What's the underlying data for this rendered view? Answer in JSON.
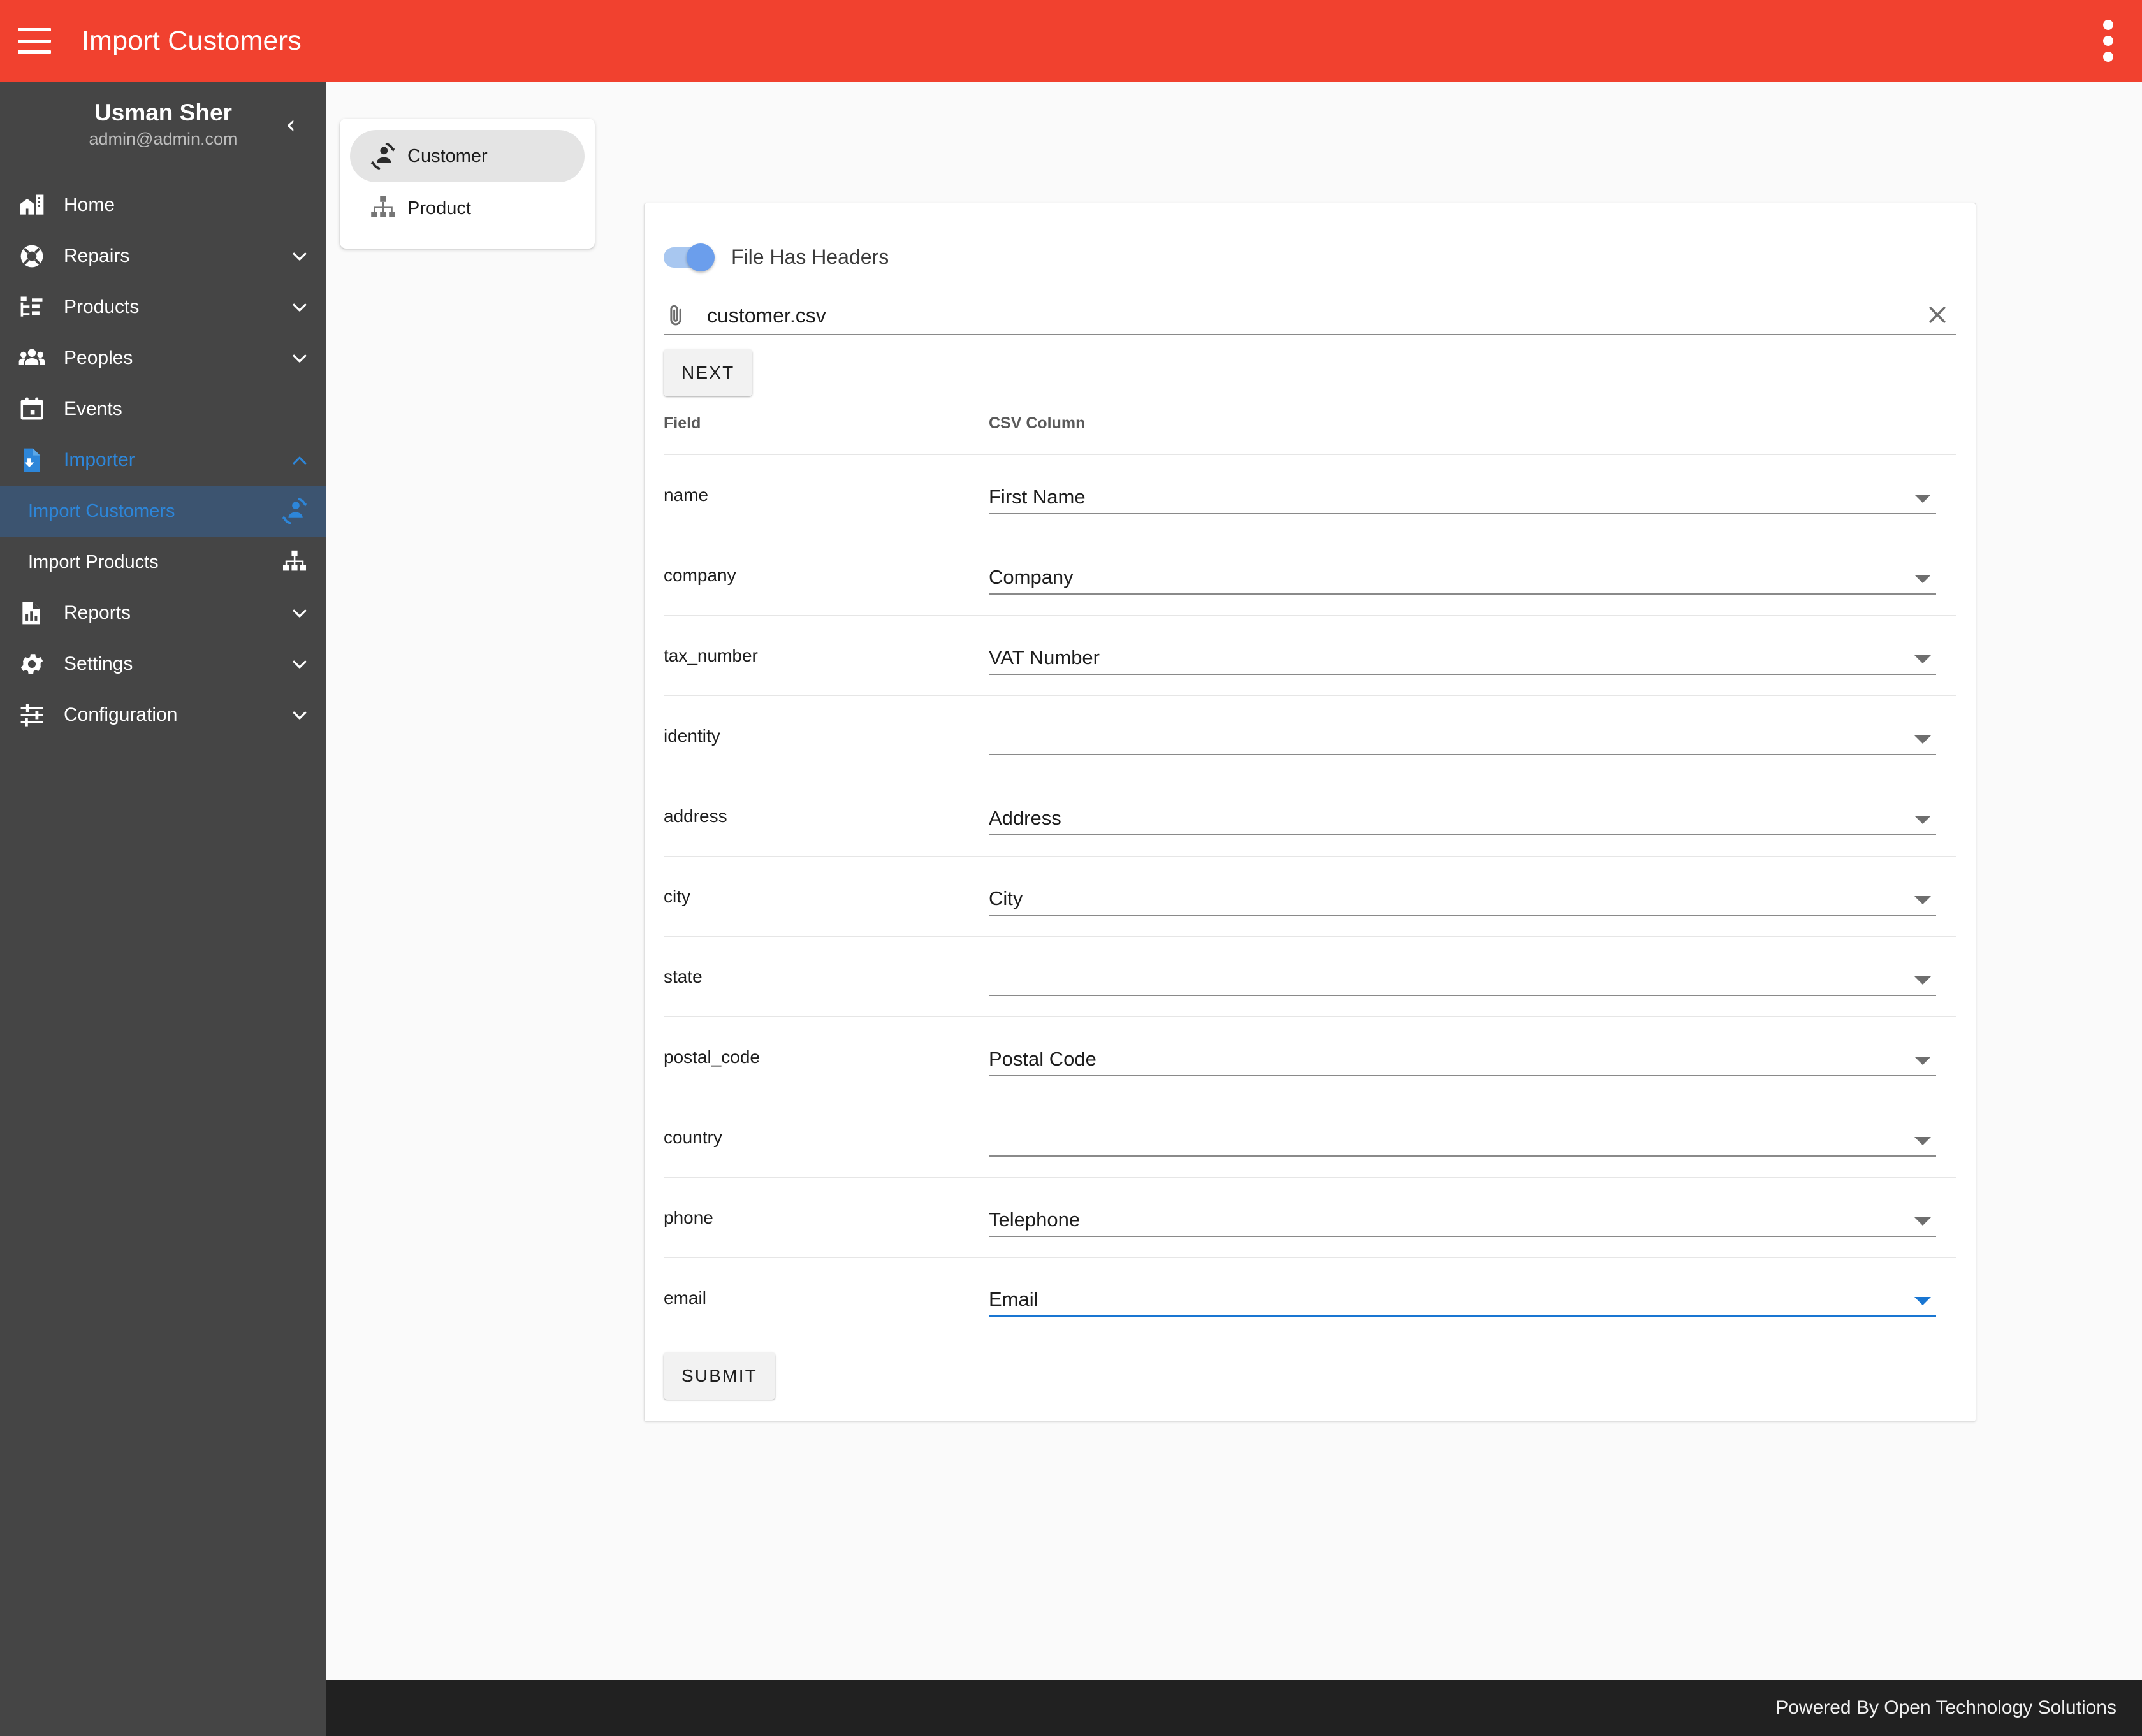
{
  "appbar": {
    "title": "Import Customers",
    "menu_icon": "hamburger-icon",
    "overflow_icon": "kebab-menu-icon"
  },
  "sidebar": {
    "user": {
      "name": "Usman Sher",
      "email": "admin@admin.com",
      "collapse_icon": "chevron-left-icon"
    },
    "items": [
      {
        "label": "Home",
        "icon": "home-building-icon",
        "expandable": false,
        "state": ""
      },
      {
        "label": "Repairs",
        "icon": "lifebuoy-icon",
        "expandable": true,
        "state": "collapsed"
      },
      {
        "label": "Products",
        "icon": "tree-list-icon",
        "expandable": true,
        "state": "collapsed"
      },
      {
        "label": "Peoples",
        "icon": "people-group-icon",
        "expandable": true,
        "state": "collapsed"
      },
      {
        "label": "Events",
        "icon": "calendar-icon",
        "expandable": false,
        "state": ""
      },
      {
        "label": "Importer",
        "icon": "file-import-icon",
        "expandable": true,
        "state": "expanded"
      }
    ],
    "importer_children": [
      {
        "label": "Import Customers",
        "icon": "customer-import-icon",
        "selected": true
      },
      {
        "label": "Import Products",
        "icon": "sitemap-icon",
        "selected": false
      }
    ],
    "items_after": [
      {
        "label": "Reports",
        "icon": "report-chart-icon",
        "expandable": true,
        "state": "collapsed"
      },
      {
        "label": "Settings",
        "icon": "gear-icon",
        "expandable": true,
        "state": "collapsed"
      },
      {
        "label": "Configuration",
        "icon": "sliders-icon",
        "expandable": true,
        "state": "collapsed"
      }
    ]
  },
  "entity_selector": {
    "items": [
      {
        "label": "Customer",
        "icon": "customer-import-icon",
        "selected": true
      },
      {
        "label": "Product",
        "icon": "sitemap-icon",
        "selected": false
      }
    ]
  },
  "form": {
    "headers_toggle": {
      "label": "File Has Headers",
      "on": true
    },
    "file": {
      "name": "customer.csv",
      "attach_icon": "paperclip-icon",
      "clear_icon": "close-icon"
    },
    "next_label": "NEXT",
    "submit_label": "SUBMIT",
    "table_headers": {
      "field": "Field",
      "csv_column": "CSV Column"
    },
    "rows": [
      {
        "field": "name",
        "csv_column": "First Name",
        "focused": false
      },
      {
        "field": "company",
        "csv_column": "Company",
        "focused": false
      },
      {
        "field": "tax_number",
        "csv_column": "VAT Number",
        "focused": false
      },
      {
        "field": "identity",
        "csv_column": "",
        "focused": false
      },
      {
        "field": "address",
        "csv_column": "Address",
        "focused": false
      },
      {
        "field": "city",
        "csv_column": "City",
        "focused": false
      },
      {
        "field": "state",
        "csv_column": "",
        "focused": false
      },
      {
        "field": "postal_code",
        "csv_column": "Postal Code",
        "focused": false
      },
      {
        "field": "country",
        "csv_column": "",
        "focused": false
      },
      {
        "field": "phone",
        "csv_column": "Telephone",
        "focused": false
      },
      {
        "field": "email",
        "csv_column": "Email",
        "focused": true
      }
    ]
  },
  "footer": {
    "text": "Powered By Open Technology Solutions"
  },
  "colors": {
    "appbar": "#F1412F",
    "sidebar": "#454545",
    "active_nav_bg": "#3C5470",
    "accent_blue": "#2D86D9",
    "focus_blue": "#1976D2",
    "toggle_on": "#6B9EEC",
    "footer_bg": "#212121",
    "page_bg": "#fafafa"
  }
}
